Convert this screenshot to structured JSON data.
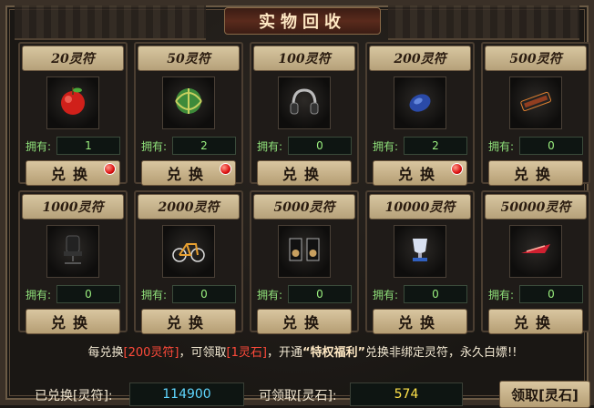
{
  "window": {
    "title": "实物回收"
  },
  "cards": [
    {
      "price": "20灵符",
      "owned_label": "拥有:",
      "owned": "1",
      "button": "兑换",
      "badge": true,
      "icon": "apple-icon"
    },
    {
      "price": "50灵符",
      "owned_label": "拥有:",
      "owned": "2",
      "button": "兑换",
      "badge": true,
      "icon": "melon-icon"
    },
    {
      "price": "100灵符",
      "owned_label": "拥有:",
      "owned": "0",
      "button": "兑换",
      "badge": false,
      "icon": "headphones-icon"
    },
    {
      "price": "200灵符",
      "owned_label": "拥有:",
      "owned": "2",
      "button": "兑换",
      "badge": true,
      "icon": "mouse-icon"
    },
    {
      "price": "500灵符",
      "owned_label": "拥有:",
      "owned": "0",
      "button": "兑换",
      "badge": false,
      "icon": "keyboard-icon"
    },
    {
      "price": "1000灵符",
      "owned_label": "拥有:",
      "owned": "0",
      "button": "兑换",
      "badge": false,
      "icon": "chair-icon"
    },
    {
      "price": "2000灵符",
      "owned_label": "拥有:",
      "owned": "0",
      "button": "兑换",
      "badge": false,
      "icon": "bicycle-icon"
    },
    {
      "price": "5000灵符",
      "owned_label": "拥有:",
      "owned": "0",
      "button": "兑换",
      "badge": false,
      "icon": "speakers-icon"
    },
    {
      "price": "10000灵符",
      "owned_label": "拥有:",
      "owned": "0",
      "button": "兑换",
      "badge": false,
      "icon": "trophy-icon"
    },
    {
      "price": "50000灵符",
      "owned_label": "拥有:",
      "owned": "0",
      "button": "兑换",
      "badge": false,
      "icon": "ship-icon"
    }
  ],
  "notice": {
    "prefix": "每兑换",
    "amount": "[200灵符]",
    "mid1": "，可领取",
    "reward": "[1灵石]",
    "mid2": "，开通",
    "privilege": "“特权福利”",
    "suffix": "兑换非绑定灵符，永久白嫖!!"
  },
  "footer": {
    "exchanged_label": "已兑换[灵符]:",
    "exchanged_value": "114900",
    "claimable_label": "可领取[灵石]:",
    "claimable_value": "574",
    "claim_button": "领取[灵石]"
  },
  "colors": {
    "owned_text": "#9bf07f",
    "exchanged_value": "#5fd6ff",
    "claimable_value": "#ffe34a",
    "highlight": "#ff4a3a"
  }
}
